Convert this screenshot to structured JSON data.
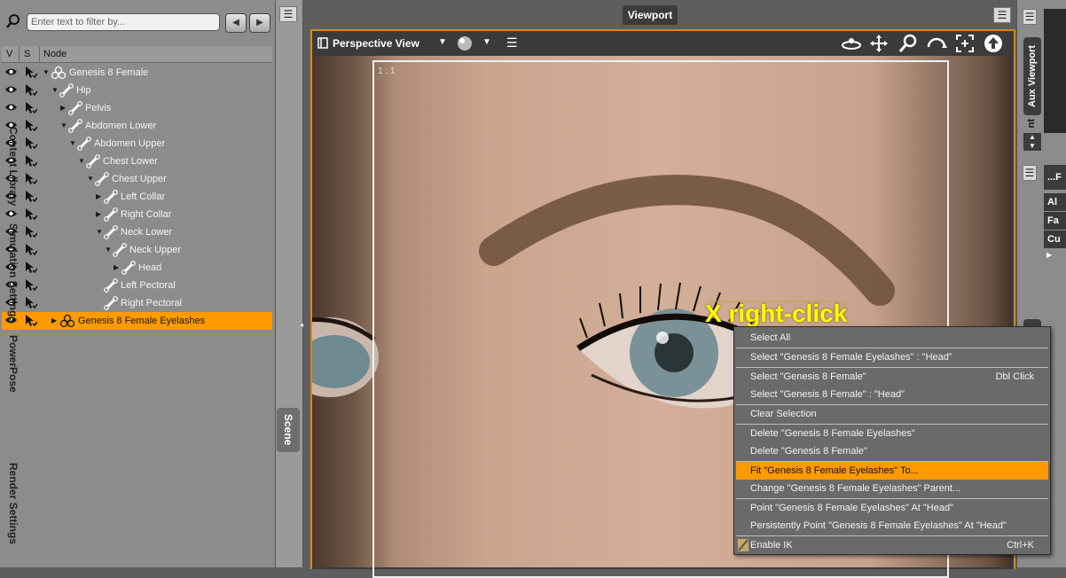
{
  "scene": {
    "filter_placeholder": "Enter text to filter by...",
    "columns": {
      "v": "V",
      "s": "S",
      "node": "Node"
    },
    "nodes": [
      {
        "label": "Genesis 8 Female"
      },
      {
        "label": "Hip"
      },
      {
        "label": "Pelvis"
      },
      {
        "label": "Abdomen Lower"
      },
      {
        "label": "Abdomen Upper"
      },
      {
        "label": "Chest Lower"
      },
      {
        "label": "Chest Upper"
      },
      {
        "label": "Left Collar"
      },
      {
        "label": "Right Collar"
      },
      {
        "label": "Neck Lower"
      },
      {
        "label": "Neck Upper"
      },
      {
        "label": "Head"
      },
      {
        "label": "Left Pectoral"
      },
      {
        "label": "Right Pectoral"
      },
      {
        "label": "Genesis 8 Female Eyelashes"
      }
    ],
    "selected_color": "#ff9a00"
  },
  "side_tabs": [
    "Content Library",
    "Simulation Settings",
    "PowerPose",
    "Scene",
    "Render Settings"
  ],
  "viewport": {
    "tab": "Viewport",
    "view_name": "Perspective View",
    "aspect_label": "1 : 1",
    "annotation": "X right-click"
  },
  "right_panel": {
    "aux_tab": "Aux Viewport",
    "partial_tab": "nt",
    "list_header": "...F",
    "list_items": [
      "Al",
      "Fa",
      "Cu"
    ]
  },
  "context_menu": {
    "items": [
      {
        "label": "Select All",
        "shortcut": ""
      },
      {
        "label": "Select \"Genesis 8 Female Eyelashes\" : \"Head\"",
        "shortcut": ""
      },
      {
        "label": "Select \"Genesis 8 Female\"",
        "shortcut": "Dbl Click"
      },
      {
        "label": "Select \"Genesis 8 Female\" : \"Head\"",
        "shortcut": ""
      },
      {
        "label": "Clear Selection",
        "shortcut": ""
      },
      {
        "label": "Delete \"Genesis 8 Female Eyelashes\"",
        "shortcut": ""
      },
      {
        "label": "Delete \"Genesis 8 Female\"",
        "shortcut": ""
      },
      {
        "label": "Fit \"Genesis 8 Female Eyelashes\" To...",
        "shortcut": ""
      },
      {
        "label": "Change \"Genesis 8 Female Eyelashes\" Parent...",
        "shortcut": ""
      },
      {
        "label": "Point \"Genesis 8 Female Eyelashes\" At \"Head\"",
        "shortcut": ""
      },
      {
        "label": "Persistently Point \"Genesis 8 Female Eyelashes\" At \"Head\"",
        "shortcut": ""
      },
      {
        "label": "Enable IK",
        "shortcut": "Ctrl+K"
      }
    ],
    "highlight_color": "#ff9a00"
  }
}
